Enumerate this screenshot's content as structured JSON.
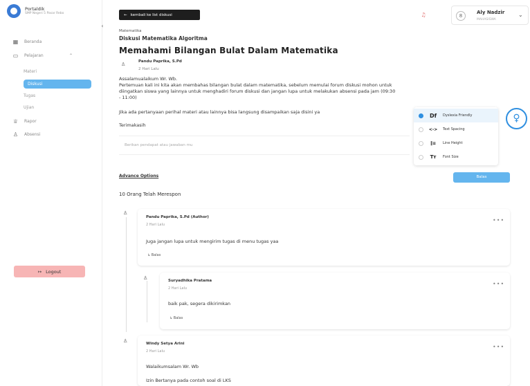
{
  "sidebar": {
    "brand_name": "Portaldik",
    "brand_sub": "SMP Negeri 5 Pasar Rebo",
    "collapse": "‹",
    "nav": {
      "beranda": "Beranda",
      "pelajaran": "Pelajaran",
      "rapor": "Rapor",
      "absensi": "Absensi"
    },
    "sub": {
      "materi": "Materi",
      "diskusi": "Diskusi",
      "tugas": "Tugas",
      "ujian": "Ujian"
    },
    "logout": "Logout"
  },
  "header": {
    "back": "kembali ke list diskusi",
    "user_name": "Aly Nadzir",
    "user_role": "MAHASISWA"
  },
  "post": {
    "subject": "Matematika",
    "discussion_title": "Diskusi Matematika Algoritma",
    "title": "Memahami Bilangan Bulat Dalam Matematika",
    "author": "Pandu Paprika, S.Pd",
    "time": "2 Hari Lalu",
    "line1": "Assalamualaikum Wr. Wb.",
    "line2": "Pertemuan kali ini kita akan membahas bilangan bulat dalam matematika, sebelum memulai forum diskusi mohon untuk",
    "line3": "diingatkan siswa yang lainnya untuk menghadiri forum diskusi dan jangan lupa untuk melakukan absensi pada jam (09:30",
    "line4": "- 11:00)",
    "line5": "Jika ada pertanyaan perihal materi atau lainnya bisa langsung disampaikan saja disini ya",
    "line6": "Terimakasih"
  },
  "comment_box": {
    "placeholder": "Berikan pendapat atau jawaban mu"
  },
  "a11y": {
    "items": [
      {
        "glyph": "Df",
        "label": "Dyslexia Friendly",
        "on": true
      },
      {
        "glyph": "<->",
        "label": "Text Spacing",
        "on": false
      },
      {
        "glyph": "‖≡",
        "label": "Line Height",
        "on": false
      },
      {
        "glyph": "Tт",
        "label": "Font Size",
        "on": false
      }
    ]
  },
  "actions": {
    "advance": "Advance Options",
    "reply": "Balas",
    "responses": "10 Orang Telah Merespon"
  },
  "comments": [
    {
      "author": "Pandu Paprika, S.Pd (Author)",
      "time": "2 Hari Lalu",
      "text": "Juga jangan lupa untuk mengirim tugas di menu tugas yaa",
      "reply": "Balas"
    },
    {
      "author": "Suryadhika Pratama",
      "time": "2 Hari Lalu",
      "text": "baik pak, segera dikirimkan",
      "reply": "Balas"
    },
    {
      "author": "Windy Setya Arini",
      "time": "2 Hari Lalu",
      "text": "Walaikumsalam Wr. Wb",
      "text2": "Izin Bertanya pada contoh soal di LKS"
    }
  ],
  "more": "•••"
}
